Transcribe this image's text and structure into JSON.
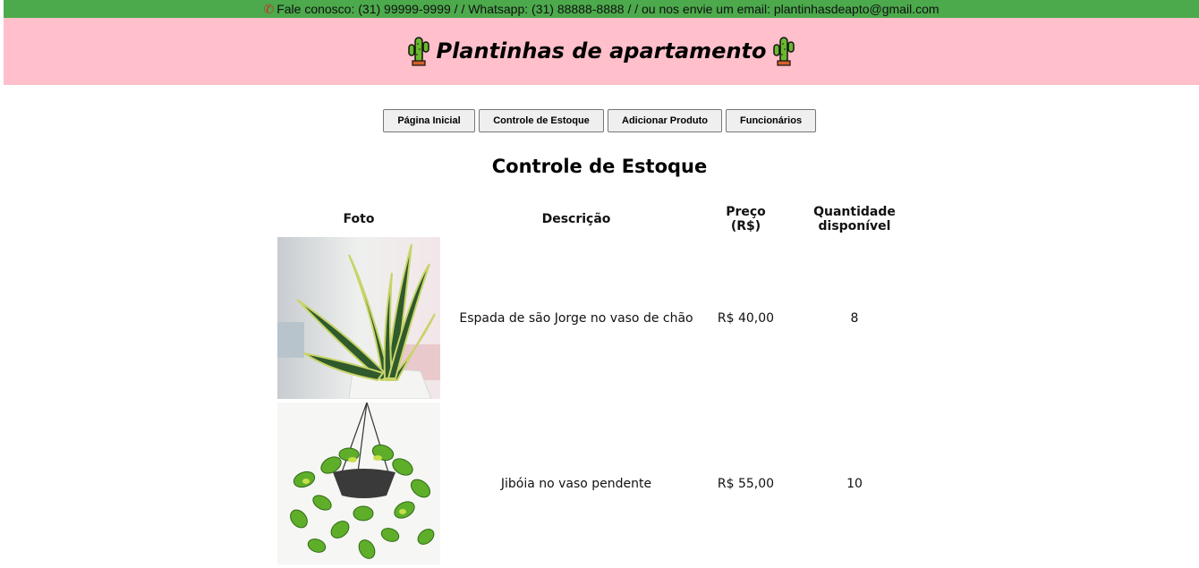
{
  "contact_bar": {
    "icon": "phone-icon",
    "text": "Fale conosco: (31) 99999-9999 / / Whatsapp: (31) 88888-8888 / / ou nos envie um email: plantinhasdeapto@gmail.com",
    "background": "#4caa4c"
  },
  "header": {
    "title": "Plantinhas de apartamento",
    "icon": "cactus-icon",
    "background": "#ffc0cb"
  },
  "nav": {
    "home": "Página Inicial",
    "stock": "Controle de Estoque",
    "add_product": "Adicionar Produto",
    "employees": "Funcionários"
  },
  "page": {
    "title": "Controle de Estoque"
  },
  "table": {
    "headers": {
      "photo": "Foto",
      "description": "Descrição",
      "price": "Preço (R$)",
      "quantity": "Quantidade disponível"
    },
    "rows": [
      {
        "photo": "snake-plant-photo",
        "description": "Espada de são Jorge no vaso de chão",
        "price": "R$ 40,00",
        "quantity": "8"
      },
      {
        "photo": "pothos-hanging-photo",
        "description": "Jibóia no vaso pendente",
        "price": "R$ 55,00",
        "quantity": "10"
      }
    ]
  }
}
